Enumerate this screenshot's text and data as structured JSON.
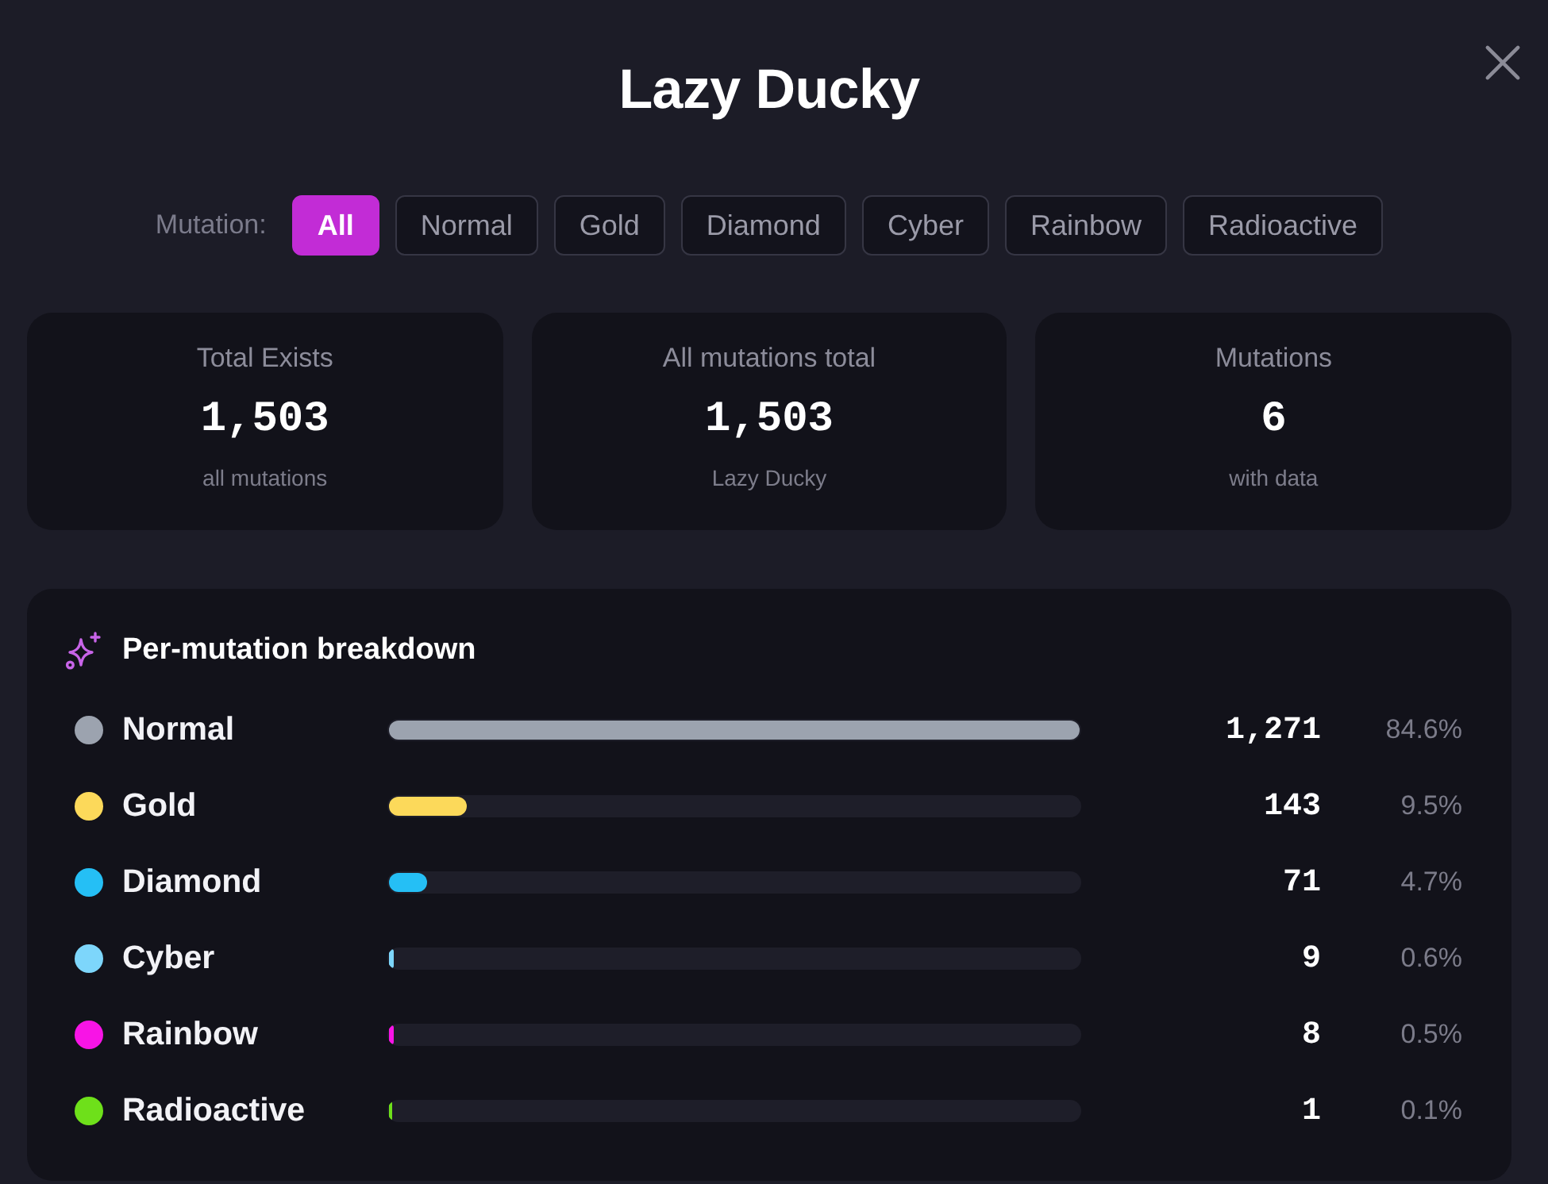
{
  "window": {
    "title": "Lazy Ducky"
  },
  "filter": {
    "label": "Mutation:",
    "options": [
      {
        "label": "All",
        "selected": true
      },
      {
        "label": "Normal",
        "selected": false
      },
      {
        "label": "Gold",
        "selected": false
      },
      {
        "label": "Diamond",
        "selected": false
      },
      {
        "label": "Cyber",
        "selected": false
      },
      {
        "label": "Rainbow",
        "selected": false
      },
      {
        "label": "Radioactive",
        "selected": false
      }
    ]
  },
  "stats": [
    {
      "label": "Total Exists",
      "value": "1,503",
      "caption": "all mutations"
    },
    {
      "label": "All mutations total",
      "value": "1,503",
      "caption": "Lazy Ducky"
    },
    {
      "label": "Mutations",
      "value": "6",
      "caption": "with data"
    }
  ],
  "breakdown": {
    "title": "Per-mutation breakdown",
    "rows": [
      {
        "name": "Normal",
        "color": "#9ca3af",
        "level": 1,
        "count": "1,271",
        "share": "84.6%"
      },
      {
        "name": "Gold",
        "color": "#fcd95a",
        "level": 0.1125,
        "count": "143",
        "share": "9.5%"
      },
      {
        "name": "Diamond",
        "color": "#25bff5",
        "level": 0.0559,
        "count": "71",
        "share": "4.7%"
      },
      {
        "name": "Cyber",
        "color": "#7dd6fb",
        "level": 0.0071,
        "count": "9",
        "share": "0.6%"
      },
      {
        "name": "Rainbow",
        "color": "#f814e6",
        "level": 0.0063,
        "count": "8",
        "share": "0.5%"
      },
      {
        "name": "Radioactive",
        "color": "#6ee01a",
        "level": 0.0008,
        "count": "1",
        "share": "0.1%"
      }
    ]
  }
}
